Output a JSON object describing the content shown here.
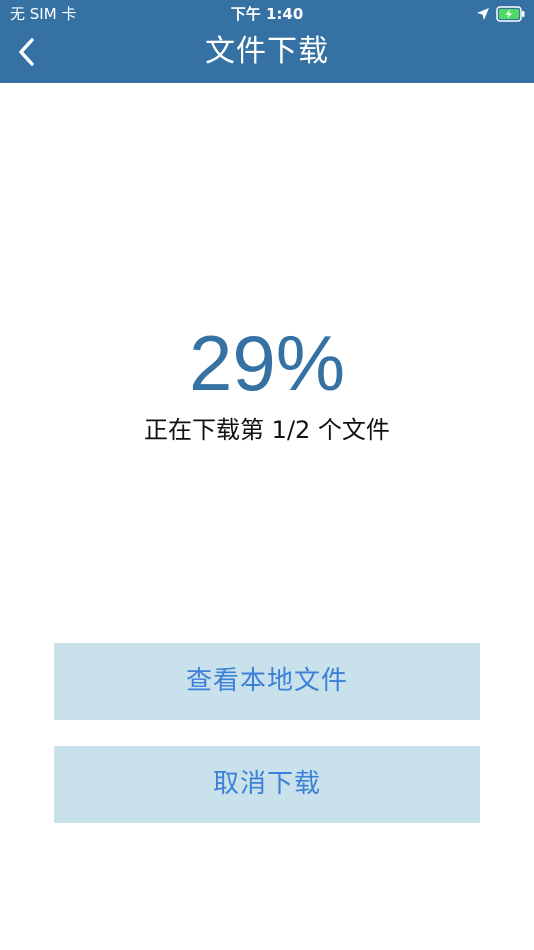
{
  "status_bar": {
    "carrier": "无 SIM 卡",
    "time": "下午 1:40",
    "icons": [
      "location-arrow-icon",
      "battery-charging-icon"
    ]
  },
  "nav": {
    "title": "文件下载",
    "back_icon": "chevron-left-icon"
  },
  "progress": {
    "percent_text": "29%",
    "percent_value": 29,
    "status_text": "正在下载第 1/2 个文件"
  },
  "buttons": {
    "view_local_files": "查看本地文件",
    "cancel_download": "取消下载"
  },
  "colors": {
    "header_bg": "#3572a3",
    "accent_text": "#3572a3",
    "button_bg": "#c8e1ea",
    "button_text": "#3d80d8",
    "battery_green": "#4cd964"
  }
}
